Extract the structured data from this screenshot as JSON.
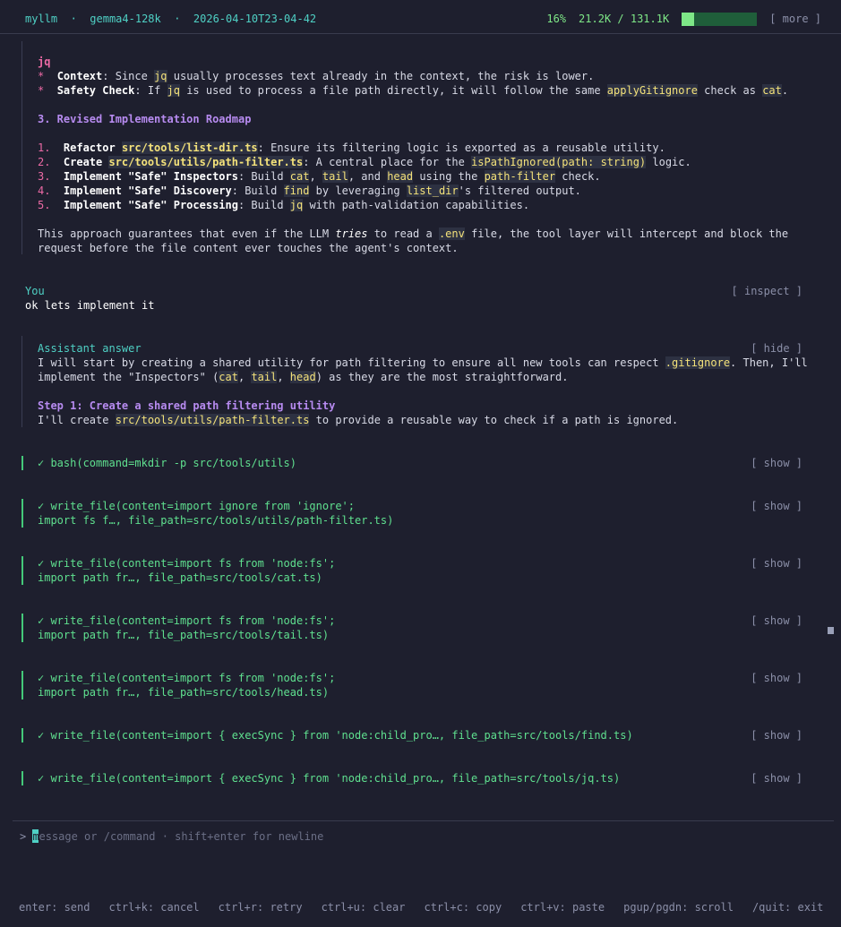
{
  "header": {
    "app": "myllm",
    "model": "gemma4-128k",
    "session": "2026-04-10T23-04-42",
    "context_pct": "16%",
    "tokens": "21.2K / 131.1K",
    "context_fraction": 0.16,
    "more_label": "[ more ]"
  },
  "prev": {
    "jq_title": "jq",
    "bullet": "*",
    "context_label": "Context",
    "context_text_1": ": Since ",
    "context_code": "jq",
    "context_text_2": " usually processes text already in the context, the risk is lower.",
    "safety_label": "Safety Check",
    "safety_text_1": ": If ",
    "safety_code_1": "jq",
    "safety_text_2": " is used to process a file path directly, it will follow the same ",
    "safety_code_2": "applyGitignore",
    "safety_text_3": " check as ",
    "safety_code_3": "cat",
    "safety_text_4": ".",
    "roadmap_heading": "3. Revised Implementation Roadmap",
    "r1_num": "1.",
    "r1_bold": "Refactor ",
    "r1_code": "src/tools/list-dir.ts",
    "r1_text": ": Ensure its filtering logic is exported as a reusable utility.",
    "r2_num": "2.",
    "r2_bold": "Create ",
    "r2_code": "src/tools/utils/path-filter.ts",
    "r2_text_1": ": A central place for the ",
    "r2_code2": "isPathIgnored(path: string)",
    "r2_text_2": " logic.",
    "r3_num": "3.",
    "r3_bold": "Implement \"Safe\" Inspectors",
    "r3_text_1": ": Build ",
    "r3_c1": "cat",
    "r3_t2": ", ",
    "r3_c2": "tail",
    "r3_t3": ", and ",
    "r3_c3": "head",
    "r3_t4": " using the ",
    "r3_c4": "path-filter",
    "r3_t5": " check.",
    "r4_num": "4.",
    "r4_bold": "Implement \"Safe\" Discovery",
    "r4_t1": ": Build ",
    "r4_c1": "find",
    "r4_t2": " by leveraging ",
    "r4_c2": "list_dir",
    "r4_t3": "'s filtered output.",
    "r5_num": "5.",
    "r5_bold": "Implement \"Safe\" Processing",
    "r5_t1": ": Build ",
    "r5_c1": "jq",
    "r5_t2": " with path-validation capabilities.",
    "closing_1a": "This approach guarantees that even if the LLM ",
    "closing_em": "tries",
    "closing_1b": " to read a ",
    "closing_code": ".env",
    "closing_1c": " file, the tool layer will intercept and block the",
    "closing_2": "request before the file content ever touches the agent's context."
  },
  "user_msg": {
    "label": "You",
    "inspect": "[ inspect ]",
    "text": "ok lets implement it"
  },
  "answer": {
    "label": "Assistant answer",
    "hide": "[ hide ]",
    "p1_a": "I will start by creating a shared utility for path filtering to ensure all new tools can respect ",
    "p1_code": ".gitignore",
    "p1_b": ". Then, I'll",
    "p2_a": "implement the \"Inspectors\" (",
    "p2_c1": "cat",
    "p2_t1": ", ",
    "p2_c2": "tail",
    "p2_t2": ", ",
    "p2_c3": "head",
    "p2_b": ") as they are the most straightforward.",
    "step_heading": "Step 1: Create a shared path filtering utility",
    "step_a": "I'll create ",
    "step_code": "src/tools/utils/path-filter.ts",
    "step_b": " to provide a reusable way to check if a path is ignored."
  },
  "tools": [
    {
      "line1": "✓ bash(command=mkdir -p src/tools/utils)",
      "line2": "",
      "show": "[ show ]"
    },
    {
      "line1": "✓ write_file(content=import ignore from 'ignore';",
      "line2": "import fs f…, file_path=src/tools/utils/path-filter.ts)",
      "show": "[ show ]"
    },
    {
      "line1": "✓ write_file(content=import fs from 'node:fs';",
      "line2": "import path fr…, file_path=src/tools/cat.ts)",
      "show": "[ show ]"
    },
    {
      "line1": "✓ write_file(content=import fs from 'node:fs';",
      "line2": "import path fr…, file_path=src/tools/tail.ts)",
      "show": "[ show ]"
    },
    {
      "line1": "✓ write_file(content=import fs from 'node:fs';",
      "line2": "import path fr…, file_path=src/tools/head.ts)",
      "show": "[ show ]"
    },
    {
      "line1": "✓ write_file(content=import { execSync } from 'node:child_pro…, file_path=src/tools/find.ts)",
      "line2": "",
      "show": "[ show ]"
    },
    {
      "line1": "✓ write_file(content=import { execSync } from 'node:child_pro…, file_path=src/tools/jq.ts)",
      "line2": "",
      "show": "[ show ]"
    }
  ],
  "input": {
    "prompt": ">",
    "caret_char": "m",
    "placeholder": "essage or /command · shift+enter for newline"
  },
  "footer": [
    "enter: send",
    "ctrl+k: cancel",
    "ctrl+r: retry",
    "ctrl+u: clear",
    "ctrl+c: copy",
    "ctrl+v: paste",
    "pgup/pgdn: scroll",
    "/quit: exit"
  ]
}
